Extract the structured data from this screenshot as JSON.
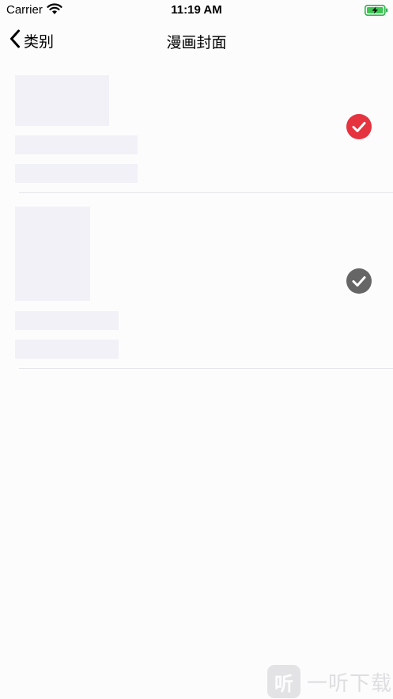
{
  "status_bar": {
    "carrier": "Carrier",
    "time": "11:19 AM"
  },
  "nav": {
    "back_label": "类别",
    "title": "漫画封面"
  },
  "list": {
    "items": [
      {
        "selected": true,
        "check_color": "#e5333f"
      },
      {
        "selected": false,
        "check_color": "#666666"
      }
    ]
  },
  "watermark": {
    "logo_text": "听",
    "text": "一听下载"
  }
}
